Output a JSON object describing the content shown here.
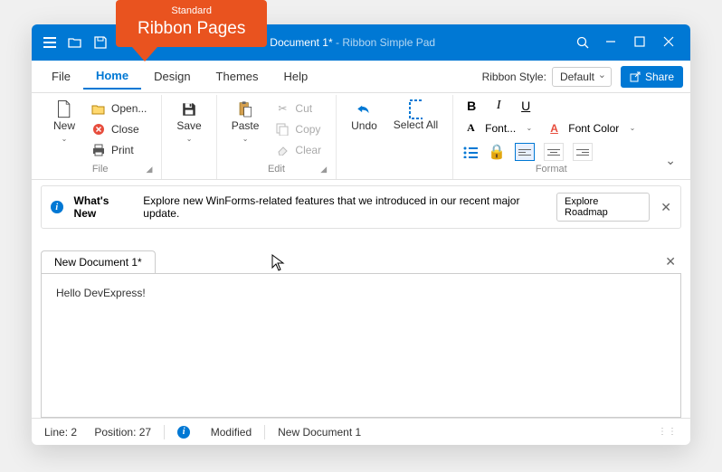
{
  "callout": {
    "small": "Standard",
    "large": "Ribbon Pages"
  },
  "titlebar": {
    "doc": "New Document 1*",
    "app": " - Ribbon Simple Pad"
  },
  "menu": {
    "tabs": [
      "File",
      "Home",
      "Design",
      "Themes",
      "Help"
    ],
    "ribbonStyleLabel": "Ribbon Style:",
    "ribbonStyleValue": "Default",
    "share": "Share"
  },
  "ribbon": {
    "file": {
      "new": "New",
      "open": "Open...",
      "close": "Close",
      "print": "Print",
      "label": "File"
    },
    "save": {
      "label": "Save"
    },
    "paste": {
      "label": "Paste"
    },
    "clip": {
      "cut": "Cut",
      "copy": "Copy",
      "clear": "Clear",
      "label": "Edit"
    },
    "history": {
      "undo": "Undo",
      "select": "Select All"
    },
    "format": {
      "font": "Font...",
      "fontColor": "Font Color",
      "label": "Format"
    }
  },
  "notice": {
    "title": "What's New",
    "body": "Explore new WinForms-related features that we introduced in our recent major update.",
    "button": "Explore Roadmap"
  },
  "doc": {
    "tab": "New Document 1*",
    "content": "Hello DevExpress!"
  },
  "status": {
    "line": "Line: 2",
    "pos": "Position: 27",
    "modified": "Modified",
    "docname": "New Document 1"
  }
}
